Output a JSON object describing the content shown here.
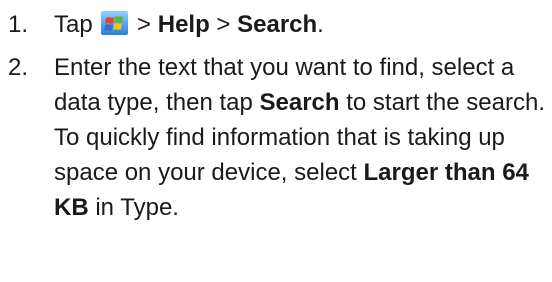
{
  "steps": [
    {
      "number": "1.",
      "before_icon": "Tap",
      "icon": "windows-start-flag-icon",
      "sep1": ">",
      "help": "Help",
      "sep2": ">",
      "search": "Search",
      "end": "."
    },
    {
      "number": "2.",
      "t1": "Enter the text that you want to find, select a data type, then tap",
      "b1": "Search",
      "t2": "to start the search. To quickly find information that is taking up space on your device, select",
      "b2": "Larger than 64 KB",
      "t3": "in Type."
    }
  ],
  "colors": {
    "text": "#1a1a1a",
    "flag_red": "#e8432a",
    "flag_green": "#5cb832",
    "flag_blue": "#2f6fd6",
    "flag_yellow": "#f7c21a"
  }
}
